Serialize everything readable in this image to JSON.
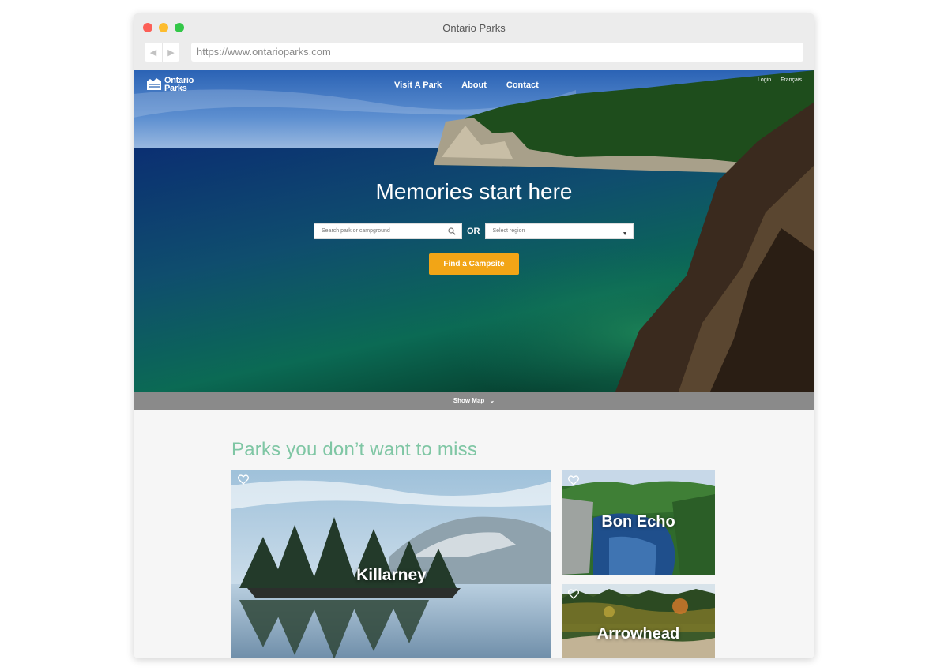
{
  "browser": {
    "title": "Ontario Parks",
    "url": "https://www.ontarioparks.com"
  },
  "header": {
    "logo_line1": "Ontario",
    "logo_line2": "Parks",
    "nav": [
      "Visit A Park",
      "About",
      "Contact"
    ],
    "utility": [
      "Login",
      "Français"
    ]
  },
  "hero": {
    "headline": "Memories start here",
    "search_placeholder": "Search park or campground",
    "or_label": "OR",
    "region_placeholder": "Select region",
    "cta_label": "Find a Campsite"
  },
  "map_toggle": {
    "label": "Show Map"
  },
  "featured": {
    "title": "Parks you don’t want to miss",
    "parks": [
      {
        "name": "Killarney"
      },
      {
        "name": "Bon Echo"
      },
      {
        "name": "Arrowhead"
      }
    ]
  },
  "colors": {
    "accent": "#f2a516",
    "section_title": "#7fc6a4",
    "map_bar": "#8a8a8a"
  }
}
